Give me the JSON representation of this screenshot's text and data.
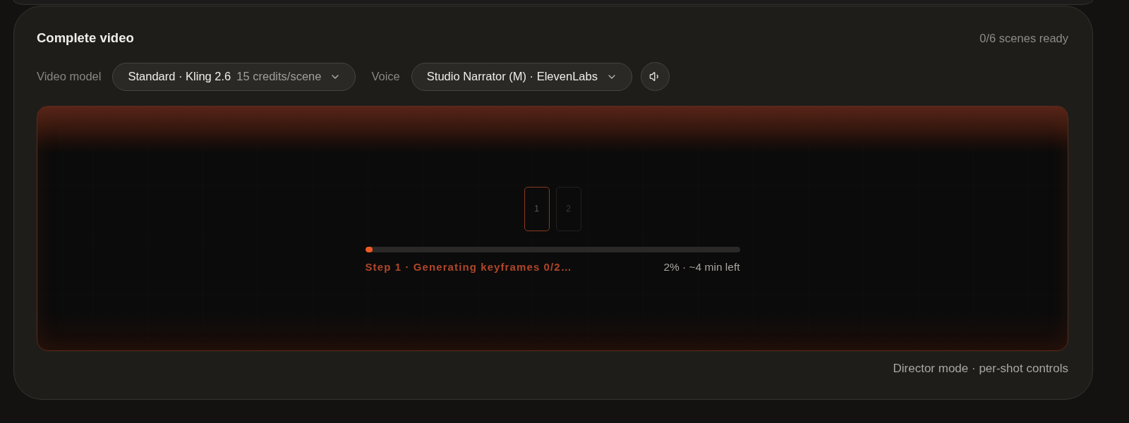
{
  "card": {
    "title": "Complete video",
    "status": "0/6 scenes ready"
  },
  "selectors": [
    {
      "label": "Video model",
      "value": "Standard · Kling 2.6",
      "detail": "15 credits/scene"
    },
    {
      "label": "Voice",
      "value": "Studio Narrator (M) · ElevenLabs"
    }
  ],
  "preview": {
    "frames": [
      {
        "label": "1",
        "selected": true
      },
      {
        "label": "2",
        "selected": false
      }
    ],
    "progress": {
      "level": 0.02,
      "step": "Step 1 · Generating keyframes 0/2…",
      "reading": "2% · ~4 min left"
    }
  },
  "footer_note": "Director mode · per-shot controls"
}
